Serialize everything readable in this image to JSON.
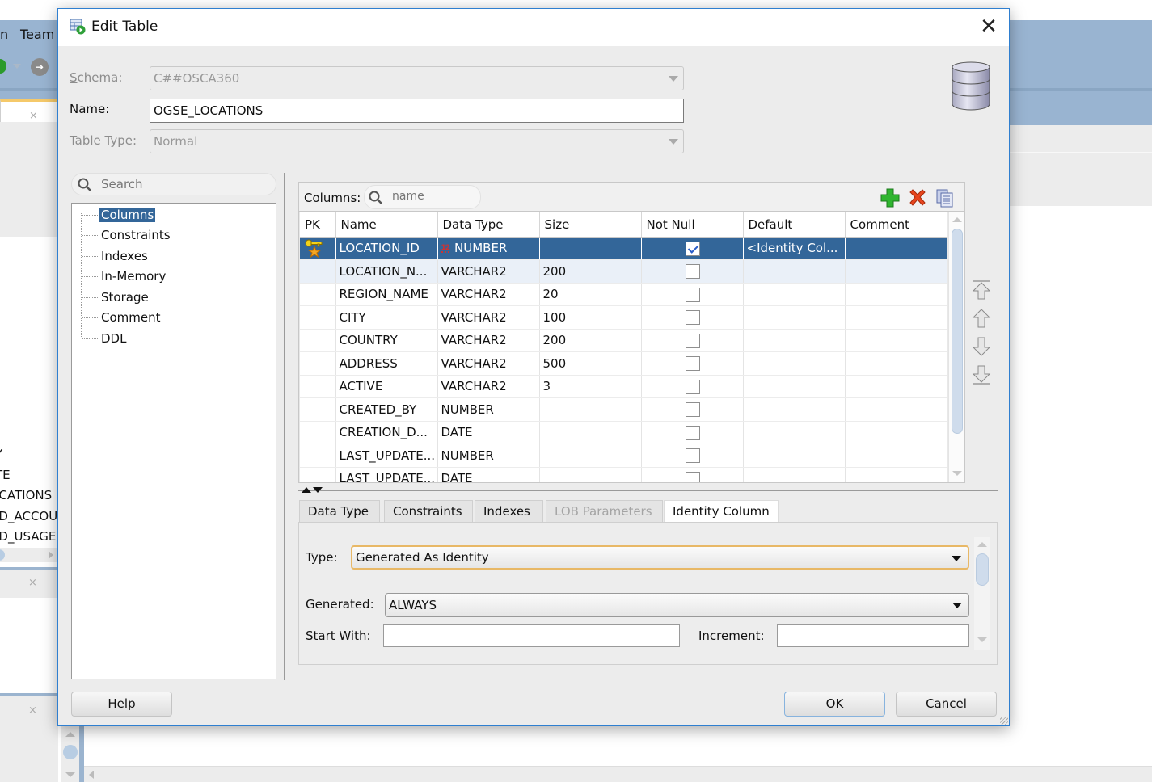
{
  "background": {
    "menu_partial_left": "n",
    "menu_team": "Team",
    "left_list_items": [
      "Y",
      "TE",
      "ICATIONS",
      "ID_ACCOU",
      "ID_USAGE"
    ]
  },
  "dialog": {
    "title": "Edit Table",
    "close_icon": "close-icon",
    "schema": {
      "label": "Schema:",
      "value": "C##OSCA360",
      "disabled": true
    },
    "name": {
      "label": "Name:",
      "value": "OGSE_LOCATIONS"
    },
    "table_type": {
      "label": "Table Type:",
      "value": "Normal",
      "disabled": true
    },
    "navigator": {
      "search_placeholder": "Search",
      "items": [
        {
          "label": "Columns",
          "selected": true
        },
        {
          "label": "Constraints"
        },
        {
          "label": "Indexes"
        },
        {
          "label": "In-Memory"
        },
        {
          "label": "Storage"
        },
        {
          "label": "Comment"
        },
        {
          "label": "DDL"
        }
      ]
    },
    "columns_panel": {
      "label": "Columns:",
      "filter_placeholder": "name",
      "toolbar": {
        "add": "add-column-icon",
        "remove": "remove-column-icon",
        "copy": "copy-column-icon"
      },
      "headers": [
        "PK",
        "Name",
        "Data Type",
        "Size",
        "Not Null",
        "Default",
        "Comment"
      ],
      "rows": [
        {
          "pk": true,
          "name": "LOCATION_ID",
          "type": "NUMBER",
          "size": "",
          "not_null": true,
          "default": "<Identity Col...",
          "comment": "",
          "selected": true
        },
        {
          "pk": false,
          "name": "LOCATION_N...",
          "type": "VARCHAR2",
          "size": "200",
          "not_null": false,
          "default": "",
          "comment": ""
        },
        {
          "pk": false,
          "name": "REGION_NAME",
          "type": "VARCHAR2",
          "size": "20",
          "not_null": false,
          "default": "",
          "comment": ""
        },
        {
          "pk": false,
          "name": "CITY",
          "type": "VARCHAR2",
          "size": "100",
          "not_null": false,
          "default": "",
          "comment": ""
        },
        {
          "pk": false,
          "name": "COUNTRY",
          "type": "VARCHAR2",
          "size": "200",
          "not_null": false,
          "default": "",
          "comment": ""
        },
        {
          "pk": false,
          "name": "ADDRESS",
          "type": "VARCHAR2",
          "size": "500",
          "not_null": false,
          "default": "",
          "comment": ""
        },
        {
          "pk": false,
          "name": "ACTIVE",
          "type": "VARCHAR2",
          "size": "3",
          "not_null": false,
          "default": "",
          "comment": ""
        },
        {
          "pk": false,
          "name": "CREATED_BY",
          "type": "NUMBER",
          "size": "",
          "not_null": false,
          "default": "",
          "comment": ""
        },
        {
          "pk": false,
          "name": "CREATION_D...",
          "type": "DATE",
          "size": "",
          "not_null": false,
          "default": "",
          "comment": ""
        },
        {
          "pk": false,
          "name": "LAST_UPDATE...",
          "type": "NUMBER",
          "size": "",
          "not_null": false,
          "default": "",
          "comment": ""
        },
        {
          "pk": false,
          "name": "LAST_UPDATE...",
          "type": "DATE",
          "size": "",
          "not_null": false,
          "default": "",
          "comment": ""
        }
      ],
      "move_buttons": [
        "move-to-top-icon",
        "move-up-icon",
        "move-down-icon",
        "move-to-bottom-icon"
      ]
    },
    "detail_tabs": [
      {
        "label": "Data Type"
      },
      {
        "label": "Constraints"
      },
      {
        "label": "Indexes"
      },
      {
        "label": "LOB Parameters",
        "disabled": true
      },
      {
        "label": "Identity Column",
        "active": true
      }
    ],
    "identity": {
      "type_label": "Type:",
      "type_value": "Generated As Identity",
      "generated_label": "Generated:",
      "generated_value": "ALWAYS",
      "start_with_label": "Start With:",
      "start_with_value": "",
      "increment_label": "Increment:",
      "increment_value": ""
    },
    "buttons": {
      "help": "Help",
      "ok": "OK",
      "cancel": "Cancel"
    }
  }
}
